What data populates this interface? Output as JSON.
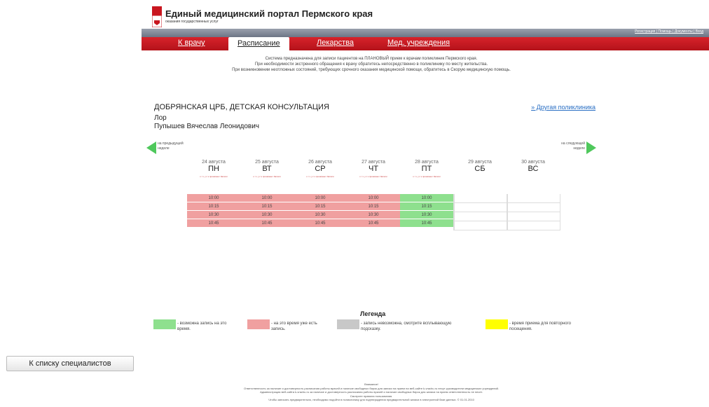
{
  "header": {
    "title": "Единый медицинский портал Пермского края",
    "subtitle": "оказания государственных услуг",
    "top_links": "Регистрация | Помощь | Документы | Вход"
  },
  "nav": {
    "items": [
      "К врачу",
      "Расписание",
      "Лекарства",
      "Мед. учреждения"
    ],
    "active": "Расписание"
  },
  "notice": [
    "Система предназначена для записи пациентов на ПЛАНОВЫЙ прием к врачам поликлиник Пермского края.",
    "При необходимости экстренного обращения к врачу обратитесь непосредственно в поликлинику по месту жительства.",
    "При возникновении неотложных состояний, требующих срочного оказания медицинской помощи, обратитесь в Скорую медицинскую помощь."
  ],
  "clinic": {
    "name": "ДОБРЯНСКАЯ ЦРБ, ДЕТСКАЯ КОНСУЛЬТАЦИЯ",
    "specialty": "Лор",
    "doctor": "Пупышев Вячеслав Леонидович",
    "other_link": "» Другая поликлиника"
  },
  "week_nav": {
    "prev": "на предыдущей неделе",
    "next": "на следующей неделе"
  },
  "days": [
    {
      "date": "24 августа",
      "weekday": "ПН",
      "note": "к т ч у с к принимает Записи",
      "status": "red",
      "times": [
        "10:00",
        "10:15",
        "10:30",
        "10:45"
      ]
    },
    {
      "date": "25 августа",
      "weekday": "ВТ",
      "note": "к т ч у с к принимает Записи",
      "status": "red",
      "times": [
        "10:00",
        "10:15",
        "10:30",
        "10:45"
      ]
    },
    {
      "date": "26 августа",
      "weekday": "СР",
      "note": "к т ч у с к принимает Записи",
      "status": "red",
      "times": [
        "10:00",
        "10:15",
        "10:30",
        "10:45"
      ]
    },
    {
      "date": "27 августа",
      "weekday": "ЧТ",
      "note": "к т ч у с к принимает Записи",
      "status": "red",
      "times": [
        "10:00",
        "10:15",
        "10:30",
        "10:45"
      ]
    },
    {
      "date": "28 августа",
      "weekday": "ПТ",
      "note": "к т ч у с к принимает Записи",
      "status": "green",
      "times": [
        "10:00",
        "10:15",
        "10:30",
        "10:45"
      ]
    },
    {
      "date": "29 августа",
      "weekday": "СБ",
      "note": "",
      "status": "empty",
      "times": []
    },
    {
      "date": "30 августа",
      "weekday": "ВС",
      "note": "",
      "status": "empty",
      "times": []
    }
  ],
  "colors": {
    "red": "#f0a0a0",
    "green": "#8ee08e",
    "gray": "#c8c8c8",
    "yellow": "#ffff00",
    "brand_red": "#c9161f"
  },
  "legend": {
    "title": "Легенда",
    "items": [
      {
        "color": "#8ee08e",
        "text": "- возможна запись на это время."
      },
      {
        "color": "#f0a0a0",
        "text": "- на это время уже есть запись."
      },
      {
        "color": "#c8c8c8",
        "text": "- запись невозможна, смотрите всплывающую подсказку."
      },
      {
        "color": "#ffff00",
        "text": "- время приема для повторного посещения."
      }
    ]
  },
  "back_button": "К списку специалистов",
  "footer": [
    "Внимание!",
    "Ответственность за наличие и достоверность расписания работы врачей и наличие свободных бирок для записи на прием на веб-сайте k-vrachu.ru несут руководители медицинских учреждений.",
    "Администрация веб-сайта k-vrachu.ru за наличие и достоверность расписания работы врачей и наличие свободных бирок для записи на прием ответственность не несет.",
    "Смотрите правила пользования.",
    "Чтобы записать предварительно, необходимо подойти в поликлинику для подтверждения предварительной записи в электронной базе данных. © 01.01.2010"
  ]
}
